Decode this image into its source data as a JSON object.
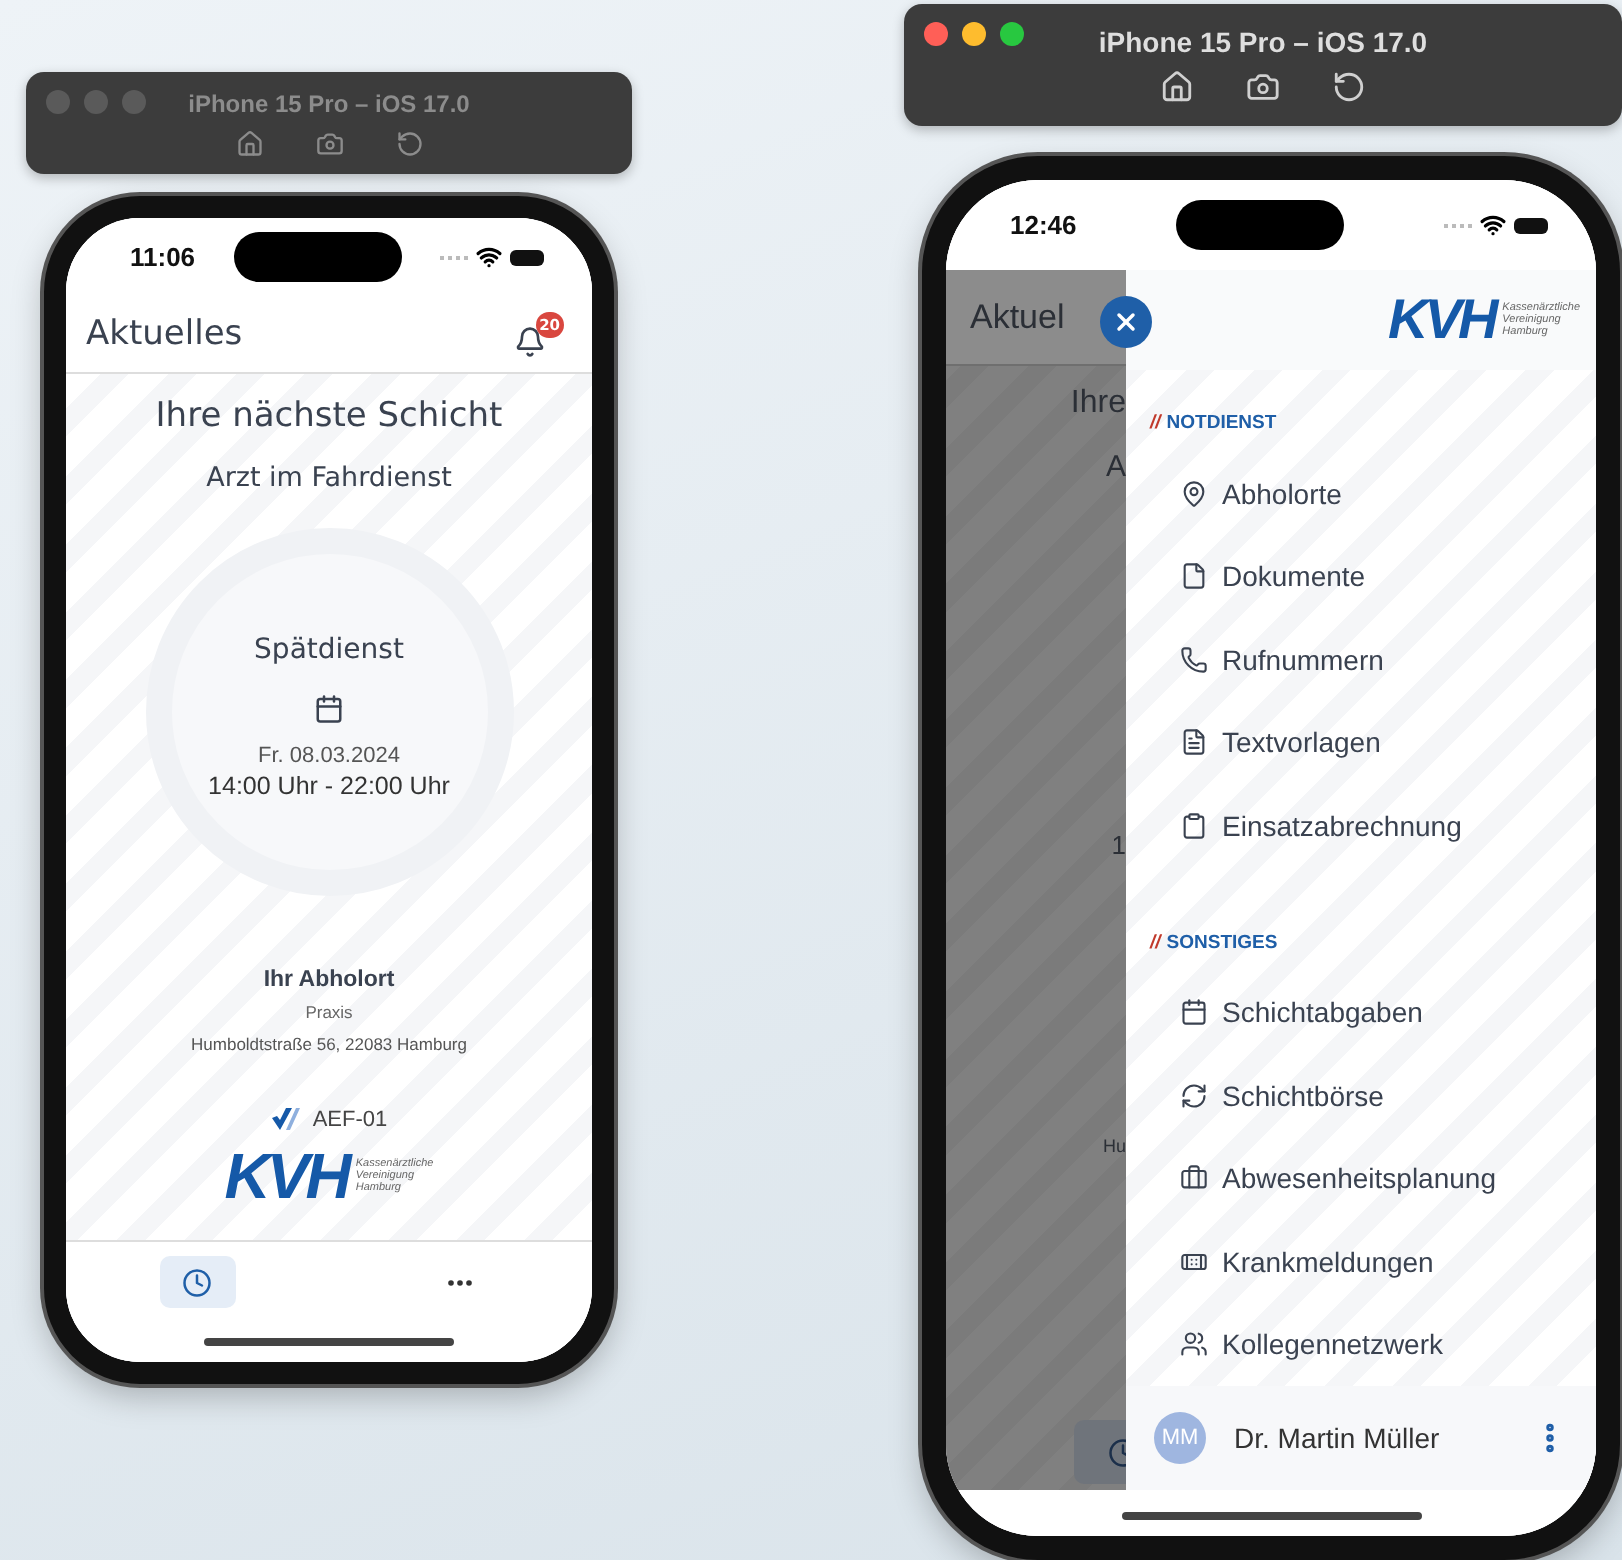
{
  "simulators": [
    {
      "title": "iPhone 15 Pro – iOS 17.0",
      "active": false,
      "time": "11:06",
      "screen": {
        "kind": "home",
        "header": {
          "title": "Aktuelles",
          "badge": "20"
        },
        "shift": {
          "heading": "Ihre nächste Schicht",
          "role": "Arzt im Fahrdienst",
          "name": "Spätdienst",
          "date": "Fr. 08.03.2024",
          "time": "14:00 Uhr - 22:00 Uhr"
        },
        "pickup": {
          "heading": "Ihr Abholort",
          "place": "Praxis",
          "address": "Humboldtstraße 56, 22083 Hamburg"
        },
        "vehicle": "AEF-01",
        "logo": {
          "mark": "KVH",
          "lines": [
            "Kassenärztliche",
            "Vereinigung",
            "Hamburg"
          ]
        },
        "nav": [
          {
            "selected": true
          },
          {
            "selected": false
          }
        ]
      }
    },
    {
      "title": "iPhone 15 Pro – iOS 17.0",
      "active": true,
      "time": "12:46",
      "screen": {
        "kind": "drawer",
        "background": {
          "title": "Aktuel",
          "fragments": [
            "Ihre",
            "A",
            "1",
            "Hu"
          ]
        },
        "logo": {
          "mark": "KVH",
          "lines": [
            "Kassenärztliche",
            "Vereinigung",
            "Hamburg"
          ]
        },
        "sections": [
          {
            "prefix": "//",
            "title": "NOTDIENST",
            "items": [
              "Abholorte",
              "Dokumente",
              "Rufnummern",
              "Textvorlagen",
              "Einsatzabrechnung"
            ]
          },
          {
            "prefix": "//",
            "title": "SONSTIGES",
            "items": [
              "Schichtabgaben",
              "Schichtbörse",
              "Abwesenheitsplanung",
              "Krankmeldungen",
              "Kollegennetzwerk"
            ]
          }
        ],
        "user": {
          "initials": "MM",
          "name": "Dr. Martin Müller"
        }
      }
    }
  ]
}
